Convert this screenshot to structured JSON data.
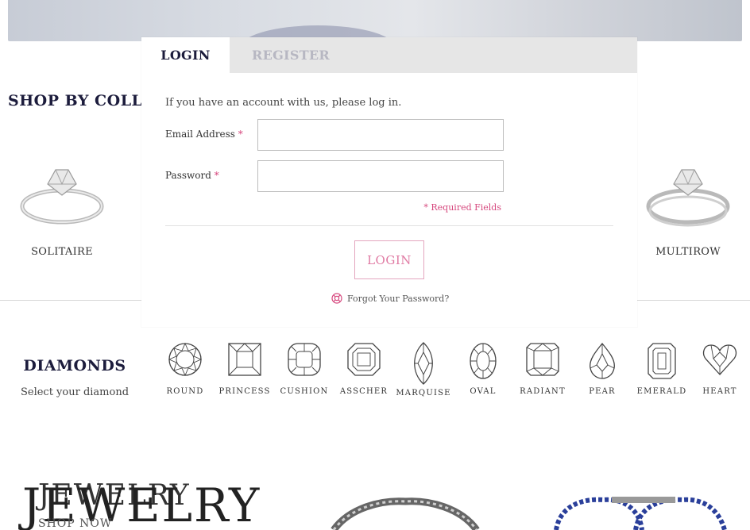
{
  "collection": {
    "title": "SHOP BY COLLEC",
    "items": [
      {
        "label": "SOLITAIRE",
        "icon": "solitaire-ring-icon"
      },
      {
        "label": "MULTIROW",
        "icon": "multirow-ring-icon"
      }
    ]
  },
  "diamonds": {
    "title": "DIAMONDS",
    "subtitle": "Select your diamond",
    "shapes": [
      {
        "label": "ROUND",
        "icon": "round-diamond-icon"
      },
      {
        "label": "PRINCESS",
        "icon": "princess-diamond-icon"
      },
      {
        "label": "CUSHION",
        "icon": "cushion-diamond-icon"
      },
      {
        "label": "ASSCHER",
        "icon": "asscher-diamond-icon"
      },
      {
        "label": "MARQUISE",
        "icon": "marquise-diamond-icon"
      },
      {
        "label": "OVAL",
        "icon": "oval-diamond-icon"
      },
      {
        "label": "RADIANT",
        "icon": "radiant-diamond-icon"
      },
      {
        "label": "PEAR",
        "icon": "pear-diamond-icon"
      },
      {
        "label": "EMERALD",
        "icon": "emerald-diamond-icon"
      },
      {
        "label": "HEART",
        "icon": "heart-diamond-icon"
      }
    ]
  },
  "jewelry": {
    "title": "JEWELRY",
    "shop_now": "SHOP NOW"
  },
  "modal": {
    "tabs": {
      "login": "LOGIN",
      "register": "REGISTER"
    },
    "intro": "If you have an account with us, please log in.",
    "email_label": "Email Address",
    "password_label": "Password",
    "required_marker": "*",
    "email_value": "",
    "password_value": "",
    "required_note": "* Required Fields",
    "login_button": "LOGIN",
    "forgot_password": "Forgot Your Password?"
  },
  "colors": {
    "navy": "#1c1c3c",
    "pink": "#e07aa3",
    "required": "#d6487e",
    "tab_inactive_bg": "#e6e6e6"
  }
}
